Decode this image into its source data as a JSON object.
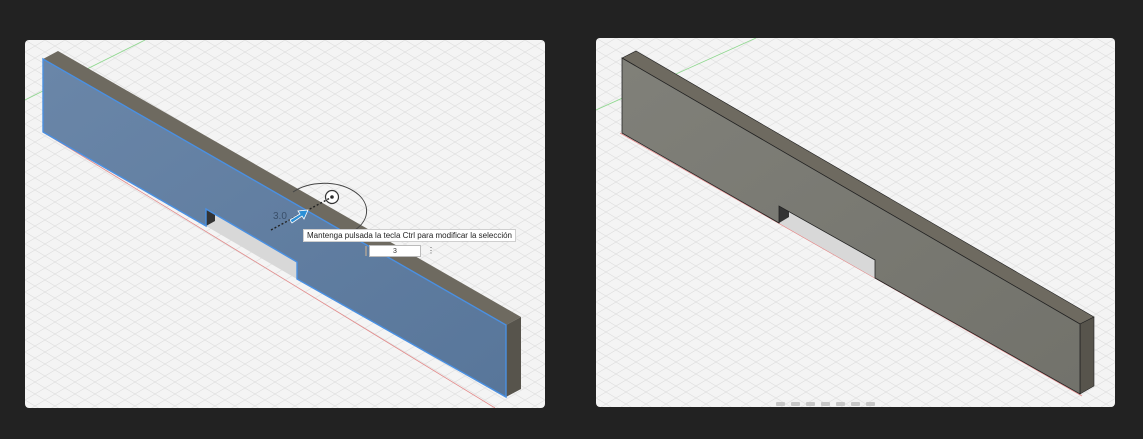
{
  "left_viewport": {
    "tooltip": "Mantenga pulsada la tecla Ctrl para modificar la selección",
    "dimension_label": "3.0",
    "dimension_input_value": "3"
  },
  "colors": {
    "selected_face": "#5f7da1",
    "selection_edge": "#4a90e2",
    "solid_face": "#7a7a72",
    "top_face": "#6e6a60",
    "grid_line": "#dcdcdc",
    "axis_green": "#66cc66",
    "axis_red": "#e06060"
  },
  "icons": [
    "move-arrow-icon",
    "rotation-handle-icon",
    "kebab-menu-icon",
    "input-handle-icon"
  ]
}
